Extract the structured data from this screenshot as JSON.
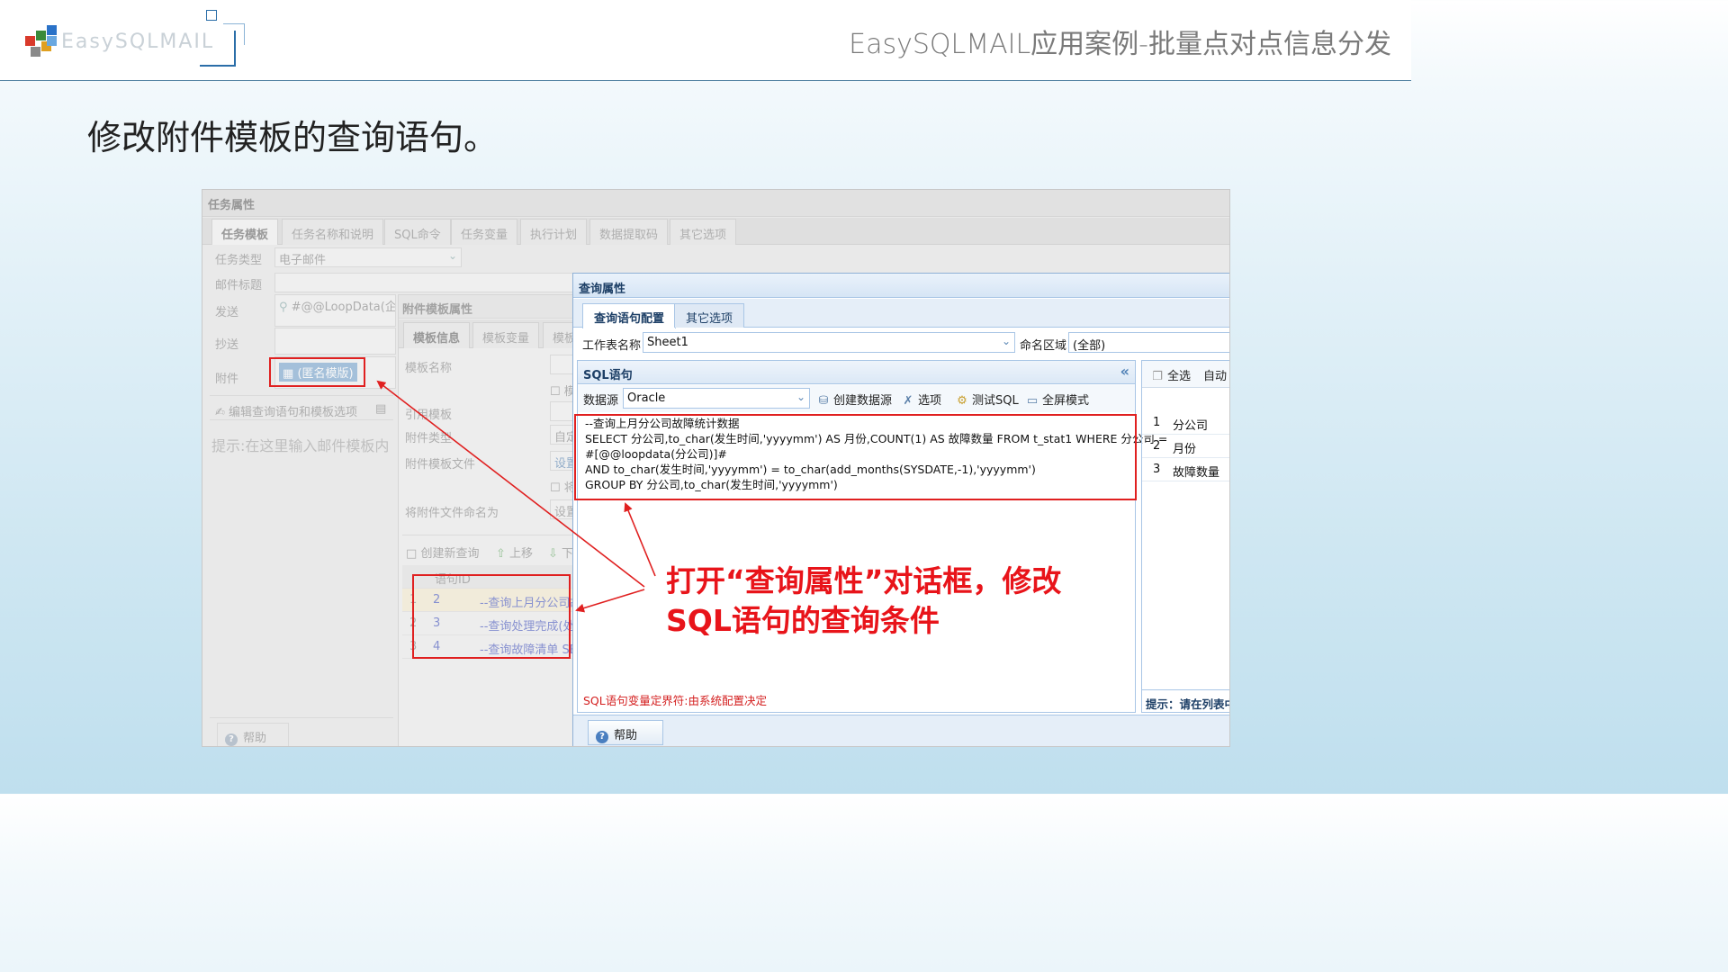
{
  "header": {
    "logo_text": "EasySQLMAIL",
    "title": "EasySQLMAIL应用案例-批量点对点信息分发"
  },
  "heading": "修改附件模板的查询语句。",
  "callout": {
    "line1": "打开“查询属性”对话框，修改",
    "line2": "SQL语句的查询条件"
  },
  "task_props": {
    "title": "任务属性",
    "tabs": [
      "任务模板",
      "任务名称和说明",
      "SQL命令",
      "任务变量",
      "执行计划",
      "数据提取码",
      "其它选项"
    ],
    "task_type_label": "任务类型",
    "task_type_value": "电子邮件",
    "mail_subject_label": "邮件标题",
    "send_label": "发送",
    "send_value": "#@@LoopData(企业",
    "cc_label": "抄送",
    "attach_label": "附件",
    "attach_value": "(匿名模版)",
    "edit_query_button": "编辑查询语句和模板选项",
    "hint": "提示:在这里输入邮件模板内",
    "help_button": "帮助"
  },
  "attach_template": {
    "title": "附件模板属性",
    "tabs": [
      "模板信息",
      "模板变量",
      "模板"
    ],
    "template_name_label": "模板名称",
    "checkbox1_label": "模",
    "ref_template_label": "引用模板",
    "attach_type_label": "附件类型",
    "attach_type_value": "自定",
    "attach_file_label": "附件模板文件",
    "attach_file_value": "设置",
    "checkbox2_label": "将",
    "name_as_label": "将附件文件命名为",
    "name_as_value": "设置",
    "toolbar": {
      "create": "创建新查询",
      "up": "上移",
      "down": "下"
    },
    "grid_header": "语句ID",
    "rows": [
      {
        "num": "1",
        "id": "2",
        "text": "--查询上月分公司故"
      },
      {
        "num": "2",
        "id": "3",
        "text": "--查询处理完成(处"
      },
      {
        "num": "3",
        "id": "4",
        "text": "--查询故障清单 SE"
      }
    ]
  },
  "query_dialog": {
    "title": "查询属性",
    "tabs": [
      "查询语句配置",
      "其它选项"
    ],
    "sheet_label": "工作表名称",
    "sheet_value": "Sheet1",
    "range_label": "命名区域",
    "range_value": "(全部)",
    "sql_panel_title": "SQL语句",
    "datasource_label": "数据源",
    "datasource_value": "Oracle",
    "toolbar": {
      "create_ds": "创建数据源",
      "options": "选项",
      "test": "测试SQL",
      "fullscreen": "全屏模式"
    },
    "sql_lines": [
      "--查询上月分公司故障统计数据",
      "SELECT 分公司,to_char(发生时间,'yyyymm') AS 月份,COUNT(1) AS 故障数量 FROM t_stat1 WHERE 分公司 =",
      "#[@@loopdata(分公司)]#",
      "AND to_char(发生时间,'yyyymm') = to_char(add_months(SYSDATE,-1),'yyyymm')",
      "GROUP BY 分公司,to_char(发生时间,'yyyymm')"
    ],
    "sql_footer": "SQL语句变量定界符:由系统配置决定",
    "right_toolbar": {
      "select_all": "全选",
      "auto": "自动"
    },
    "columns": [
      {
        "num": "1",
        "name": "分公司"
      },
      {
        "num": "2",
        "name": "月份"
      },
      {
        "num": "3",
        "name": "故障数量"
      }
    ],
    "right_hint": "提示：请在列表中",
    "help_button": "帮助"
  },
  "colors": {
    "accent_red": "#e8141a",
    "dialog_border": "#8fb1d6",
    "title_blue": "#1d3f66"
  }
}
